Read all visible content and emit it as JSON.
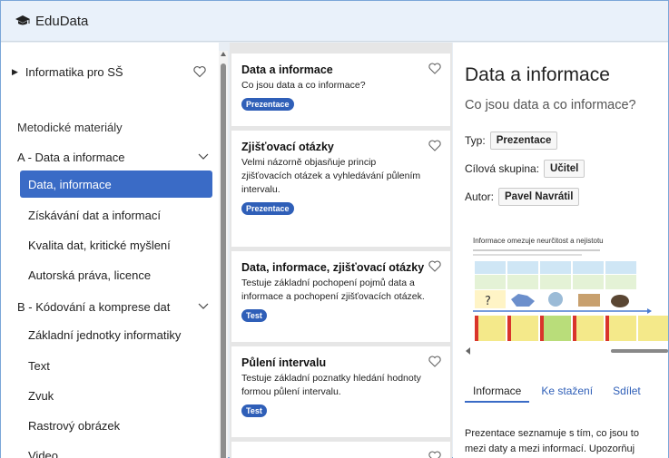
{
  "app": {
    "title": "EduData",
    "logo_icon": "graduation-cap-icon"
  },
  "sidebar": {
    "course": {
      "label": "Informatika pro SŠ",
      "favorite_icon": "heart-outline-icon"
    },
    "section_title": "Metodické materiály",
    "groups": [
      {
        "label": "A - Data a informace",
        "expanded": true,
        "items": [
          {
            "label": "Data, informace",
            "active": true
          },
          {
            "label": "Získávání dat a informací"
          },
          {
            "label": "Kvalita dat, kritické myšlení"
          },
          {
            "label": "Autorská práva, licence"
          }
        ]
      },
      {
        "label": "B - Kódování a komprese dat",
        "expanded": true,
        "items": [
          {
            "label": "Základní jednotky informatiky"
          },
          {
            "label": "Text"
          },
          {
            "label": "Zvuk"
          },
          {
            "label": "Rastrový obrázek"
          },
          {
            "label": "Video"
          }
        ]
      }
    ]
  },
  "list": {
    "cards": [
      {
        "title": "Data a informace",
        "description": "Co jsou data a co informace?",
        "badge": "Prezentace"
      },
      {
        "title": "Zjišťovací otázky",
        "description": "Velmi názorně objasňuje princip zjišťovacích otázek a vyhledávání půlením intervalu.",
        "description_lines": [
          "Velmi názorně objasňuje princip",
          "zjišťovacích otázek a vyhledávání půlením",
          "intervalu."
        ],
        "badge": "Prezentace"
      },
      {
        "title": "Data, informace, zjišťovací otázky",
        "description_lines": [
          "Testuje základní pochopení pojmů data a",
          "informace a pochopení zjišťovacích otázek."
        ],
        "badge": "Test"
      },
      {
        "title": "Půlení intervalu",
        "description_lines": [
          "Testuje základní poznatky hledání hodnoty",
          "formou půlení intervalu."
        ],
        "badge": "Test"
      }
    ]
  },
  "detail": {
    "title": "Data a informace",
    "subtitle": "Co jsou data a co informace?",
    "type_label": "Typ:",
    "type_value": "Prezentace",
    "audience_label": "Cílová skupina:",
    "audience_value": "Učitel",
    "author_label": "Autor:",
    "author_value": "Pavel Navrátil",
    "preview_heading": "Informace omezuje neurčitost a nejistotu",
    "tabs": [
      "Informace",
      "Ke stažení",
      "Sdílet"
    ],
    "active_tab": "Informace",
    "description_lines": [
      "Prezentace seznamuje s tím, co jsou to",
      "mezi daty a mezi informací. Upozorňuj"
    ]
  },
  "colors": {
    "accent": "#3a6bc6",
    "badge": "#2f5fb8",
    "header_bg": "#e9f1fa"
  }
}
